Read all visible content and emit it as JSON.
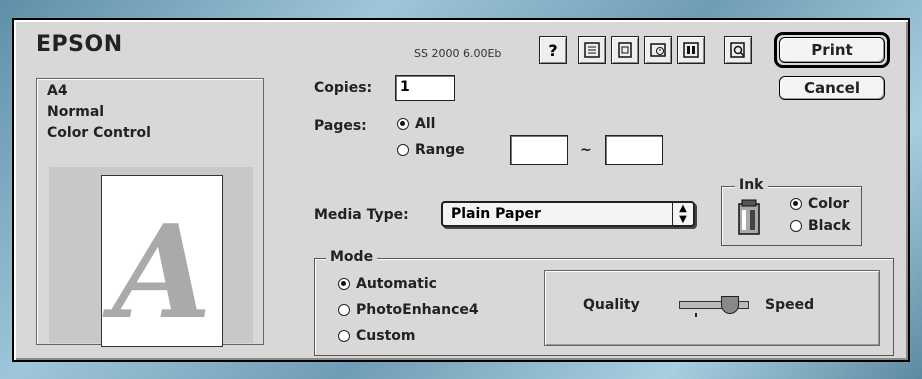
{
  "header": {
    "brand": "EPSON",
    "version": "SS 2000 6.00Eb"
  },
  "toolbar": {
    "help_label": "?",
    "icons": [
      "help-icon",
      "paper-config-icon",
      "layout-icon",
      "background-printing-icon",
      "status-monitor-icon",
      "preview-icon"
    ]
  },
  "actions": {
    "print_label": "Print",
    "cancel_label": "Cancel"
  },
  "summary": {
    "paper_size": "A4",
    "quality": "Normal",
    "color": "Color Control",
    "preview_letter": "A"
  },
  "copies": {
    "label": "Copies:",
    "value": "1"
  },
  "pages": {
    "label": "Pages:",
    "all_label": "All",
    "range_label": "Range",
    "selected": "All",
    "range_from": "",
    "range_to": "",
    "separator": "~"
  },
  "media": {
    "label": "Media Type:",
    "value": "Plain Paper"
  },
  "ink": {
    "legend": "Ink",
    "color_label": "Color",
    "black_label": "Black",
    "selected": "Color"
  },
  "mode": {
    "legend": "Mode",
    "options": [
      "Automatic",
      "PhotoEnhance4",
      "Custom"
    ],
    "selected": "Automatic",
    "quality_label": "Quality",
    "speed_label": "Speed",
    "slider_position": 0.8
  },
  "colors": {
    "dialog_bg": "#d8d8d8",
    "preview_letter": "#aaaaaa"
  }
}
